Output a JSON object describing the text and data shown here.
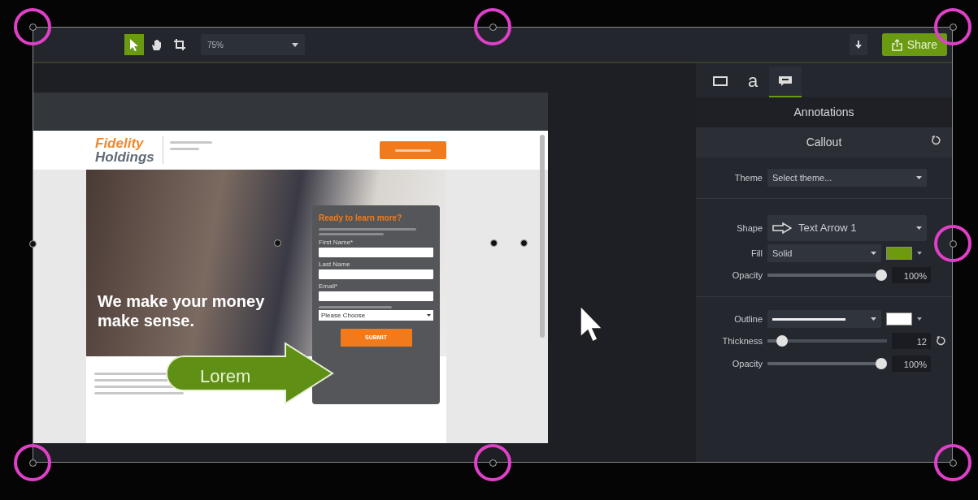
{
  "toolbar": {
    "tools": [
      {
        "kind": "pointer",
        "selected": true
      },
      {
        "kind": "hand",
        "selected": false
      },
      {
        "kind": "crop",
        "selected": false
      }
    ],
    "zoom": "75%",
    "share_button": "Share"
  },
  "canvas": {
    "webpage": {
      "logo_top": "Fidelity",
      "logo_bottom": "Holdings",
      "hero_text": "We make your money make sense.",
      "form_title": "Ready to learn more?",
      "fields": [
        {
          "label": "First Name*",
          "kind": "text"
        },
        {
          "label": "Last Name",
          "kind": "text"
        },
        {
          "label": "Email*",
          "kind": "text"
        },
        {
          "label": "Please Choose",
          "kind": "select"
        }
      ],
      "submit_button": "SUBMIT"
    },
    "callout": {
      "text": "Lorem",
      "color": "#5f8f14"
    }
  },
  "properties": {
    "tabs": [
      {
        "kind": "rectangle",
        "selected": false
      },
      {
        "kind": "text",
        "label": "a",
        "selected": false
      },
      {
        "kind": "callout",
        "selected": true
      }
    ],
    "heading": "Annotations",
    "subheading": "Callout",
    "theme": {
      "label": "Theme",
      "value": "Select theme..."
    },
    "shape": {
      "label": "Shape",
      "value": "Text Arrow 1"
    },
    "fill": {
      "label": "Fill",
      "value": "Solid",
      "color": "#6e9a0f"
    },
    "fill_opacity": {
      "label": "Opacity",
      "level": 1.0,
      "reading": "100%"
    },
    "outline": {
      "label": "Outline",
      "color": "#ffffff"
    },
    "thickness": {
      "label": "Thickness",
      "level": 0.08,
      "reading": "12"
    },
    "outline_opacity": {
      "label": "Opacity",
      "level": 1.0,
      "reading": "100%"
    }
  }
}
